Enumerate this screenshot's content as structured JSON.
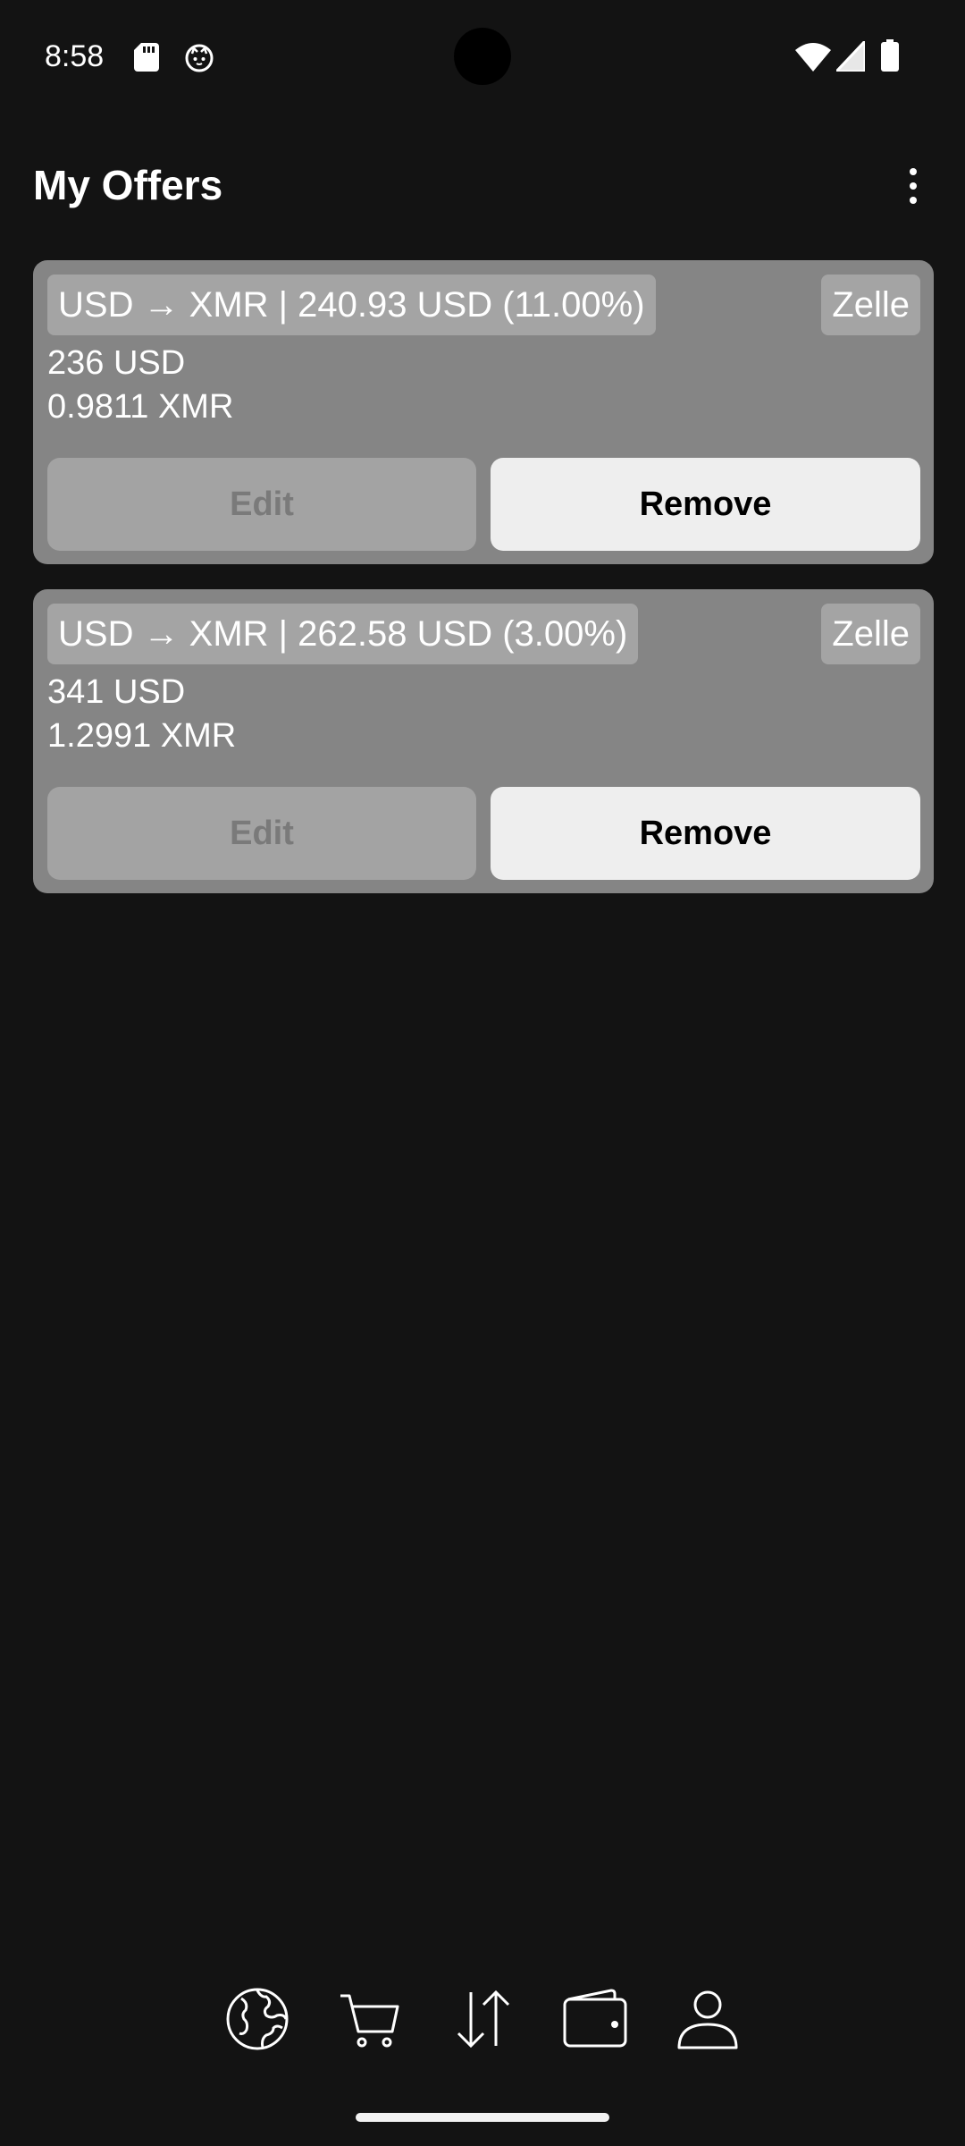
{
  "status_bar": {
    "time": "8:58",
    "icons": [
      "sd-card-icon",
      "cat-face-icon",
      "wifi-icon",
      "cell-signal-icon",
      "battery-icon"
    ]
  },
  "header": {
    "title": "My Offers",
    "menu_icon": "more-vertical-icon"
  },
  "offers": [
    {
      "pair_label": "USD → XMR | 240.93 USD (11.00%)",
      "payment_method": "Zelle",
      "fiat_amount": "236 USD",
      "crypto_amount": "0.9811 XMR",
      "edit_label": "Edit",
      "remove_label": "Remove"
    },
    {
      "pair_label": "USD → XMR | 262.58 USD (3.00%)",
      "payment_method": "Zelle",
      "fiat_amount": "341 USD",
      "crypto_amount": "1.2991 XMR",
      "edit_label": "Edit",
      "remove_label": "Remove"
    }
  ],
  "bottom_nav": {
    "items": [
      "globe-icon",
      "cart-icon",
      "swap-arrows-icon",
      "wallet-icon",
      "person-icon"
    ]
  },
  "colors": {
    "background": "#131313",
    "card": "#858585",
    "chip": "#a4a4a4",
    "edit_button": "#a3a3a3",
    "remove_button": "#eeeeee"
  }
}
